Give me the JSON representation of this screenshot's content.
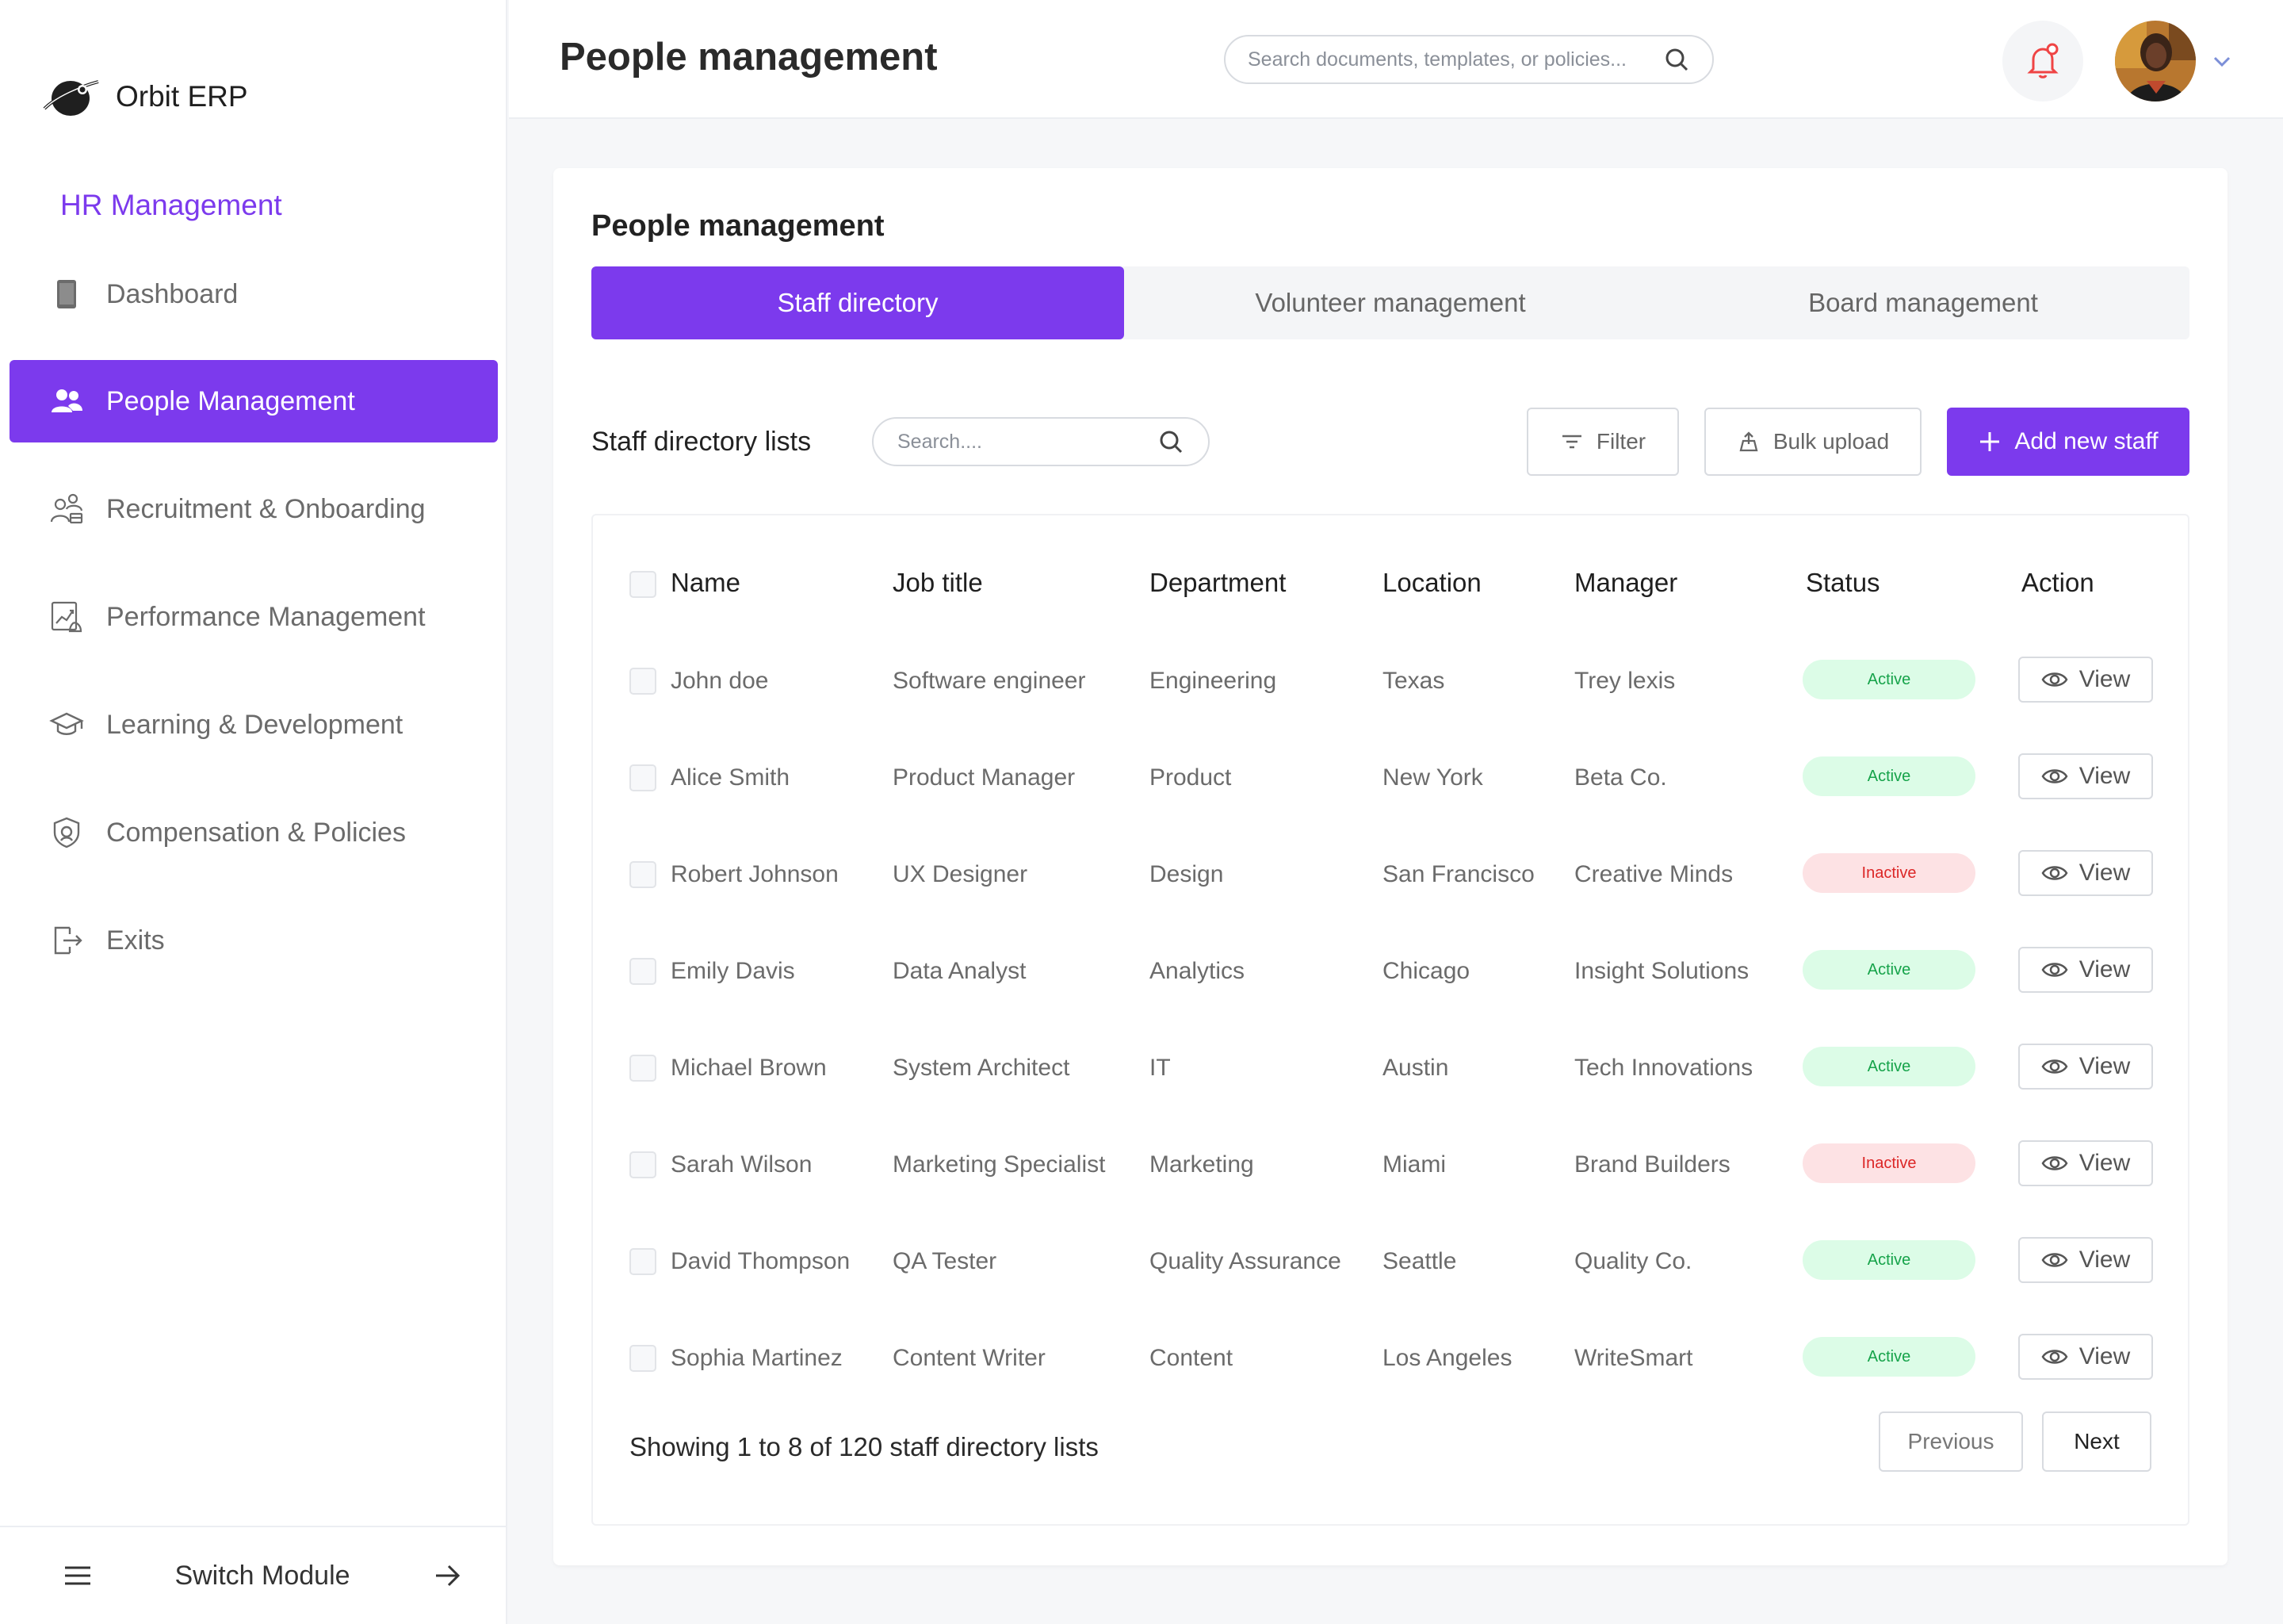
{
  "brand": {
    "name": "Orbit ERP"
  },
  "sidebar": {
    "module_title": "HR Management",
    "items": [
      {
        "label": "Dashboard",
        "icon": "tablet-icon"
      },
      {
        "label": "People Management",
        "icon": "users-icon",
        "active": true
      },
      {
        "label": "Recruitment & Onboarding",
        "icon": "recruitment-icon"
      },
      {
        "label": "Performance Management",
        "icon": "performance-chart-icon"
      },
      {
        "label": "Learning & Development",
        "icon": "graduation-cap-icon"
      },
      {
        "label": "Compensation & Policies",
        "icon": "shield-icon"
      },
      {
        "label": "Exits",
        "icon": "exit-icon"
      }
    ],
    "footer": {
      "switch_label": "Switch Module"
    }
  },
  "header": {
    "title": "People management",
    "search_placeholder": "Search documents, templates, or policies..."
  },
  "card": {
    "title": "People management",
    "tabs": [
      "Staff directory",
      "Volunteer management",
      "Board management"
    ],
    "active_tab": "Staff directory"
  },
  "toolbar": {
    "list_title": "Staff directory lists",
    "search_placeholder": "Search....",
    "filter_label": "Filter",
    "bulk_label": "Bulk upload",
    "add_label": "Add new staff"
  },
  "table": {
    "columns": [
      "Name",
      "Job title",
      "Department",
      "Location",
      "Manager",
      "Status",
      "Action"
    ],
    "view_label": "View",
    "rows": [
      {
        "name": "John doe",
        "job": "Software engineer",
        "dept": "Engineering",
        "loc": "Texas",
        "mgr": "Trey lexis",
        "status": "Active"
      },
      {
        "name": "Alice Smith",
        "job": "Product Manager",
        "dept": "Product",
        "loc": "New York",
        "mgr": "Beta Co.",
        "status": "Active"
      },
      {
        "name": "Robert Johnson",
        "job": "UX Designer",
        "dept": "Design",
        "loc": "San Francisco",
        "mgr": "Creative Minds",
        "status": "Inactive"
      },
      {
        "name": "Emily Davis",
        "job": "Data Analyst",
        "dept": "Analytics",
        "loc": "Chicago",
        "mgr": "Insight Solutions",
        "status": "Active"
      },
      {
        "name": "Michael Brown",
        "job": "System Architect",
        "dept": "IT",
        "loc": "Austin",
        "mgr": "Tech Innovations",
        "status": "Active"
      },
      {
        "name": "Sarah Wilson",
        "job": "Marketing Specialist",
        "dept": "Marketing",
        "loc": "Miami",
        "mgr": "Brand Builders",
        "status": "Inactive"
      },
      {
        "name": "David Thompson",
        "job": "QA Tester",
        "dept": "Quality Assurance",
        "loc": "Seattle",
        "mgr": "Quality Co.",
        "status": "Active"
      },
      {
        "name": "Sophia Martinez",
        "job": "Content Writer",
        "dept": "Content",
        "loc": "Los Angeles",
        "mgr": "WriteSmart",
        "status": "Active"
      }
    ]
  },
  "pagination": {
    "info": "Showing 1 to 8 of 120 staff directory lists",
    "prev_label": "Previous",
    "next_label": "Next"
  },
  "colors": {
    "accent": "#7c3aed",
    "active_bg": "#dcfce7",
    "active_text": "#16a34a",
    "inactive_bg": "#fde2e4",
    "inactive_text": "#dc2626",
    "notification": "#ef4444"
  }
}
